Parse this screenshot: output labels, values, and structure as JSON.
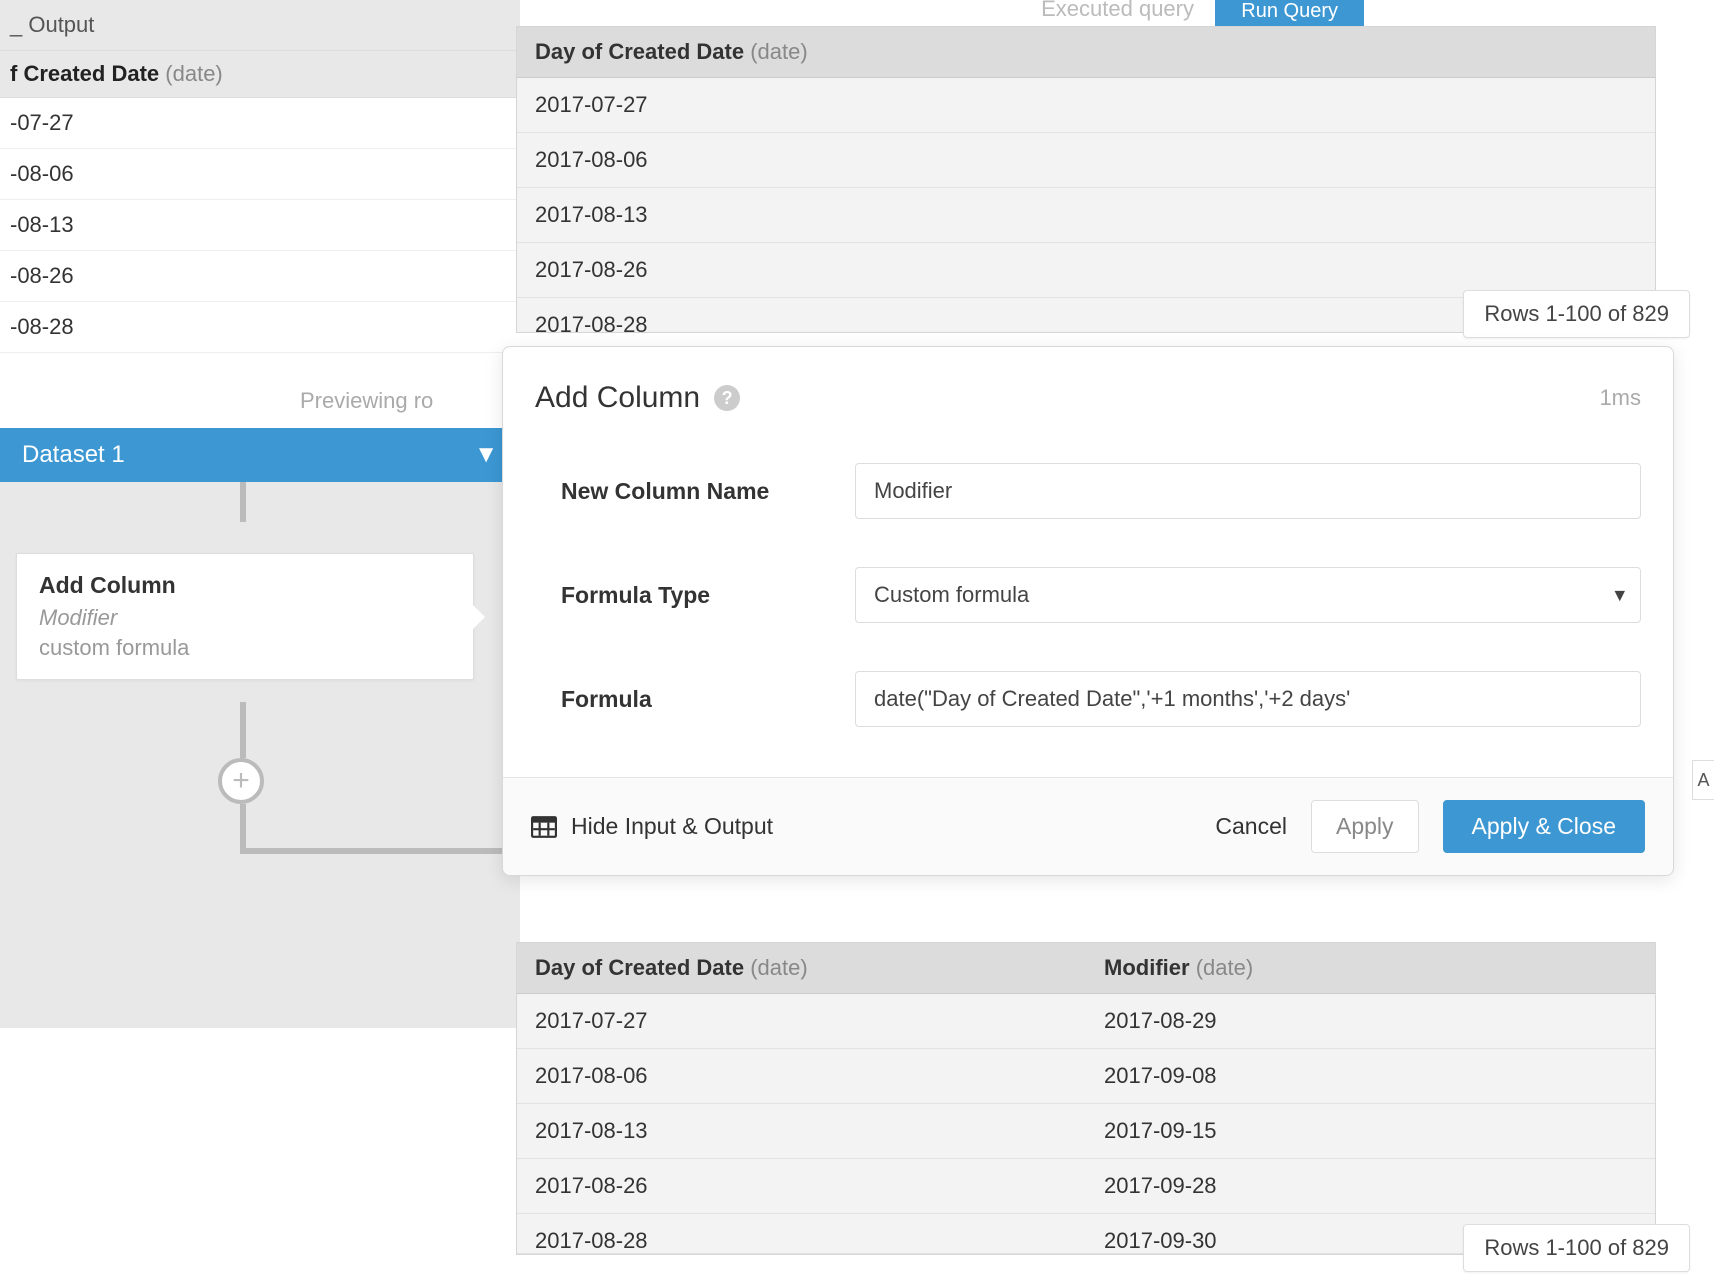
{
  "bg_left": {
    "output_fragment": "_ Output",
    "col_label_fragment": "f Created Date",
    "col_type": "(date)",
    "rows": [
      "-07-27",
      "-08-06",
      "-08-13",
      "-08-26",
      "-08-28"
    ]
  },
  "previewing": "Previewing ro",
  "pipeline": {
    "dataset_label": "Dataset 1",
    "card_title": "Add Column",
    "card_subtitle": "Modifier",
    "card_formula": "custom formula"
  },
  "top_buttons": {
    "executed": "Executed query",
    "run_query": "Run Query"
  },
  "preview1": {
    "col_label": "Day of Created Date",
    "col_type": "(date)",
    "rows": [
      "2017-07-27",
      "2017-08-06",
      "2017-08-13",
      "2017-08-26",
      "2017-08-28"
    ],
    "rows_badge": "Rows 1-100 of 829"
  },
  "modal": {
    "title": "Add Column",
    "timing": "1ms",
    "fields": {
      "name_label": "New Column Name",
      "name_value": "Modifier",
      "type_label": "Formula Type",
      "type_value": "Custom formula",
      "formula_label": "Formula",
      "formula_value": "date(\"Day of Created Date\",'+1 months','+2 days'"
    },
    "footer": {
      "hide_io": "Hide Input & Output",
      "cancel": "Cancel",
      "apply": "Apply",
      "apply_close": "Apply & Close"
    }
  },
  "preview2": {
    "col1_label": "Day of Created Date",
    "col1_type": "(date)",
    "col2_label": "Modifier",
    "col2_type": "(date)",
    "rows": [
      {
        "a": "2017-07-27",
        "b": "2017-08-29"
      },
      {
        "a": "2017-08-06",
        "b": "2017-09-08"
      },
      {
        "a": "2017-08-13",
        "b": "2017-09-15"
      },
      {
        "a": "2017-08-26",
        "b": "2017-09-28"
      },
      {
        "a": "2017-08-28",
        "b": "2017-09-30"
      }
    ],
    "rows_badge": "Rows 1-100 of 829"
  },
  "side_tab": "A"
}
